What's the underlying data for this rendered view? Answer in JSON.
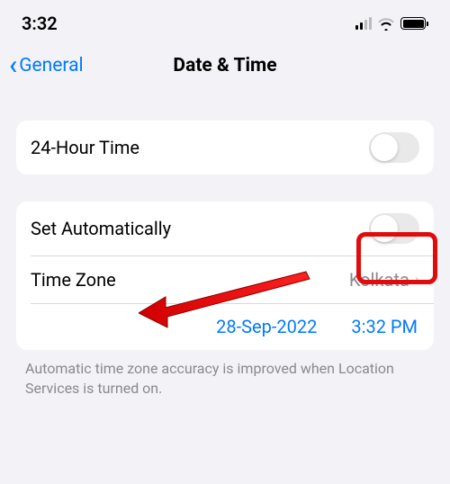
{
  "statusBar": {
    "time": "3:32"
  },
  "nav": {
    "backLabel": "General",
    "title": "Date & Time"
  },
  "group1": {
    "row1": {
      "label": "24-Hour Time"
    }
  },
  "group2": {
    "row1": {
      "label": "Set Automatically"
    },
    "row2": {
      "label": "Time Zone",
      "value": "Kolkata"
    },
    "row3": {
      "date": "28-Sep-2022",
      "time": "3:32 PM"
    }
  },
  "footer": "Automatic time zone accuracy is improved when Location Services is turned on."
}
